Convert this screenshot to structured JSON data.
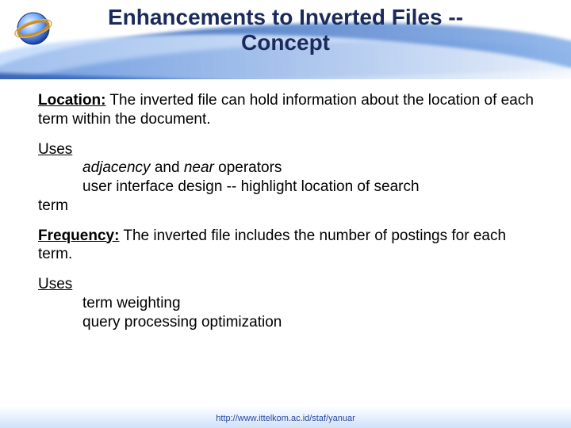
{
  "title_line1": "Enhancements to Inverted Files --",
  "title_line2": "Concept",
  "location": {
    "label": "Location:",
    "text": "  The inverted file can hold information about the location of each term within the document."
  },
  "uses_label": "Uses",
  "loc_uses": {
    "line1a": "adjacency",
    "line1b": " and ",
    "line1c": "near",
    "line1d": " operators",
    "line2": "user interface design -- highlight location of search",
    "line3": "term"
  },
  "frequency": {
    "label": "Frequency:",
    "text": "  The inverted file includes the number of postings for each term."
  },
  "freq_uses": {
    "line1": "term weighting",
    "line2": "query processing optimization"
  },
  "footer_url": "http://www.ittelkom.ac.id/staf/yanuar"
}
